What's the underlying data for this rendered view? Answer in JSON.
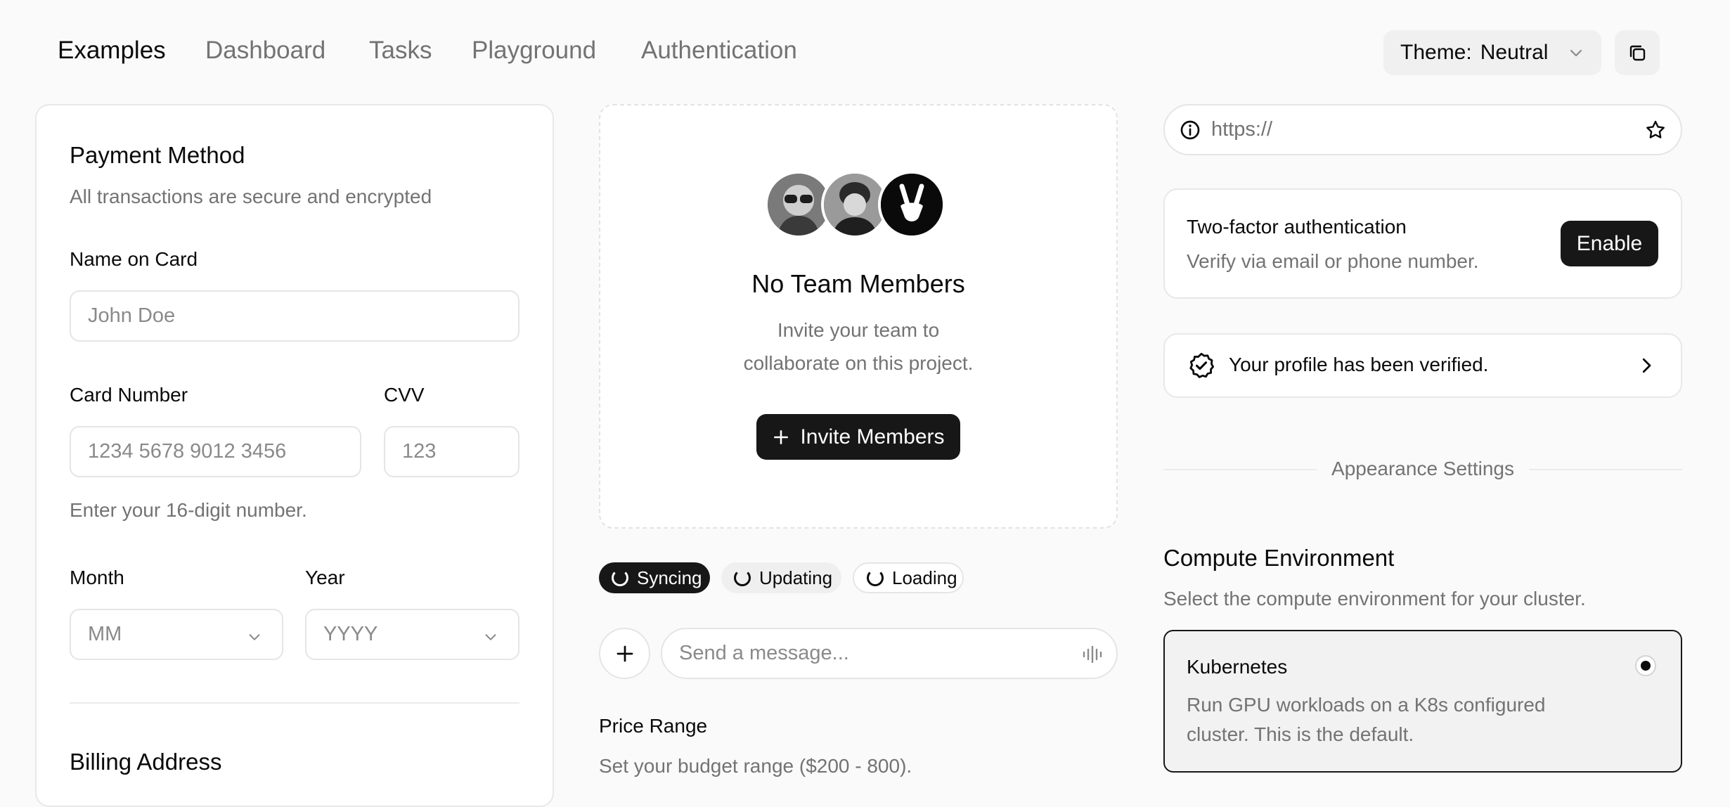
{
  "nav": {
    "examples": "Examples",
    "dashboard": "Dashboard",
    "tasks": "Tasks",
    "playground": "Playground",
    "authentication": "Authentication",
    "theme_label": "Theme:",
    "theme_value": "Neutral"
  },
  "payment": {
    "title": "Payment Method",
    "subtitle": "All transactions are secure and encrypted",
    "name_label": "Name on Card",
    "name_placeholder": "John Doe",
    "card_label": "Card Number",
    "card_placeholder": "1234 5678 9012 3456",
    "cvv_label": "CVV",
    "cvv_placeholder": "123",
    "card_help": "Enter your 16-digit number.",
    "month_label": "Month",
    "month_value": "MM",
    "year_label": "Year",
    "year_value": "YYYY",
    "billing_title": "Billing Address"
  },
  "team": {
    "title": "No Team Members",
    "desc_line1": "Invite your team to",
    "desc_line2": "collaborate on this project.",
    "invite_label": "Invite Members"
  },
  "status_chips": [
    "Syncing",
    "Updating",
    "Loading"
  ],
  "message": {
    "placeholder": "Send a message..."
  },
  "price": {
    "title": "Price Range",
    "desc": "Set your budget range ($200 - 800)."
  },
  "url": {
    "value": "https://"
  },
  "twofa": {
    "title": "Two-factor authentication",
    "desc": "Verify via email or phone number.",
    "button": "Enable"
  },
  "verified": {
    "text": "Your profile has been verified."
  },
  "appearance": {
    "label": "Appearance Settings"
  },
  "compute": {
    "title": "Compute Environment",
    "desc": "Select the compute environment for your cluster.",
    "option_title": "Kubernetes",
    "option_desc_line1": "Run GPU workloads on a K8s configured",
    "option_desc_line2": "cluster. This is the default."
  },
  "colors": {
    "primary": "#171717",
    "muted": "#737373",
    "border": "#e5e5e5",
    "background": "#fafafa"
  }
}
